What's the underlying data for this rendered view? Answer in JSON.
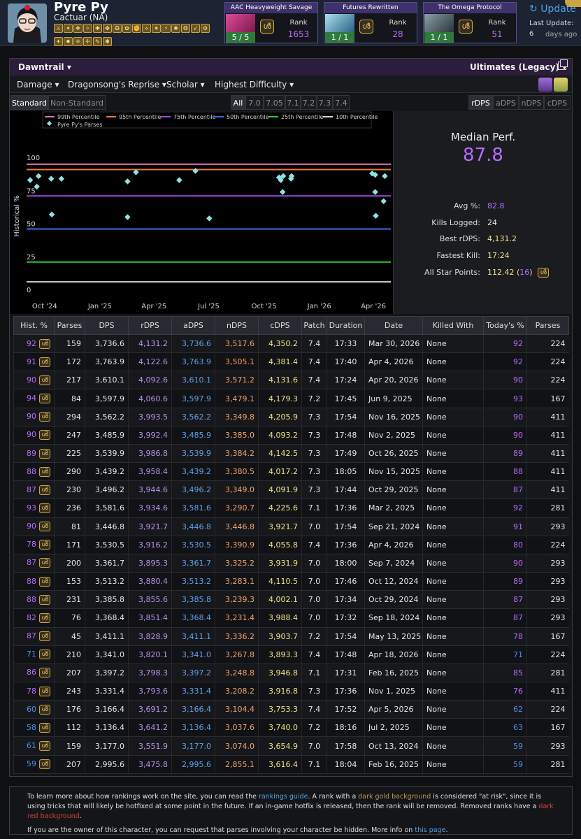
{
  "character": {
    "name": "Pyre Py",
    "server": "Cactuar (NA)"
  },
  "job_icons": [
    "paladin-icon",
    "warrior-icon",
    "dark-knight-icon",
    "gunbreaker-icon",
    "white-mage-icon",
    "scholar-icon",
    "astrologian-icon",
    "sage-icon",
    "monk-icon",
    "dragoon-icon",
    "ninja-icon",
    "samurai-icon",
    "reaper-icon",
    "viper-icon",
    "bard-icon",
    "machinist-icon",
    "dancer-icon",
    "black-mage-icon",
    "summoner-icon",
    "red-mage-icon",
    "pictomancer-icon",
    "blue-mage-icon"
  ],
  "raids": [
    {
      "title": "AAC Heavyweight Savage",
      "kills": "5 / 5",
      "rank_label": "Rank",
      "rank": "1653",
      "kills_bg": "#2e7a3a"
    },
    {
      "title": "Futures Rewritten",
      "kills": "1 / 1",
      "rank_label": "Rank",
      "rank": "28",
      "kills_bg": "#2e7a3a"
    },
    {
      "title": "The Omega Protocol",
      "kills": "1 / 1",
      "rank_label": "Rank",
      "rank": "51",
      "kills_bg": "#2e7a3a"
    }
  ],
  "update": {
    "button_label": "Update",
    "last_update_label": "Last Update:",
    "last_update_value": "6",
    "last_update_ago": "days ago"
  },
  "expac_bar": {
    "expansion": "Dawntrail",
    "zone": "Ultimates (Legacy)"
  },
  "filters": {
    "metric": "Damage",
    "encounter": "Dragonsong's Reprise",
    "job": "Scholar",
    "difficulty": "Highest Difficulty"
  },
  "tabs": {
    "partition": [
      "Standard",
      "Non-Standard"
    ],
    "patches": [
      "All",
      "7.0",
      "7.05",
      "7.1",
      "7.2",
      "7.3",
      "7.4"
    ],
    "metrics": [
      "rDPS",
      "aDPS",
      "nDPS",
      "cDPS"
    ]
  },
  "chart_data": {
    "type": "line",
    "ylabel": "Historical %",
    "ylim": [
      0,
      100
    ],
    "yticks": [
      "0",
      "25",
      "50",
      "75",
      "100"
    ],
    "xticks": [
      "Oct '24",
      "Jan '25",
      "Apr '25",
      "Jul '25",
      "Oct '25",
      "Jan '26",
      "Apr '26"
    ],
    "legend": [
      {
        "name": "99th Percentile",
        "color": "#e072b5"
      },
      {
        "name": "95th Percentile",
        "color": "#e87c3a"
      },
      {
        "name": "75th Percentile",
        "color": "#9a4ae0"
      },
      {
        "name": "50th Percentile",
        "color": "#3a6ee8"
      },
      {
        "name": "25th Percentile",
        "color": "#32c832"
      },
      {
        "name": "10th Percentile",
        "color": "#d8d8d8"
      },
      {
        "name": "Pyre Py's Parses",
        "color": "#8fe3e3"
      }
    ],
    "percentile_lines": [
      {
        "name": "99th Percentile",
        "value": 99
      },
      {
        "name": "95th Percentile",
        "value": 95
      },
      {
        "name": "75th Percentile",
        "value": 75
      },
      {
        "name": "50th Percentile",
        "value": 50
      },
      {
        "name": "25th Percentile",
        "value": 25
      },
      {
        "name": "10th Percentile",
        "value": 10
      }
    ],
    "parses": [
      {
        "date": "2024-09-07",
        "value": 87
      },
      {
        "date": "2024-09-18",
        "value": 82
      },
      {
        "date": "2024-09-21",
        "value": 90
      },
      {
        "date": "2024-10-12",
        "value": 88
      },
      {
        "date": "2024-10-13",
        "value": 61
      },
      {
        "date": "2024-10-29",
        "value": 88
      },
      {
        "date": "2025-02-16",
        "value": 86
      },
      {
        "date": "2025-02-16",
        "value": 59
      },
      {
        "date": "2025-03-02",
        "value": 93
      },
      {
        "date": "2025-05-13",
        "value": 87
      },
      {
        "date": "2025-06-09",
        "value": 94
      },
      {
        "date": "2025-07-02",
        "value": 58
      },
      {
        "date": "2025-10-26",
        "value": 89
      },
      {
        "date": "2025-10-29",
        "value": 87
      },
      {
        "date": "2025-11-01",
        "value": 78
      },
      {
        "date": "2025-11-02",
        "value": 90
      },
      {
        "date": "2025-11-15",
        "value": 88
      },
      {
        "date": "2025-11-16",
        "value": 90
      },
      {
        "date": "2026-03-30",
        "value": 92
      },
      {
        "date": "2026-04-04",
        "value": 91
      },
      {
        "date": "2026-04-04",
        "value": 78
      },
      {
        "date": "2026-04-05",
        "value": 60
      },
      {
        "date": "2026-04-18",
        "value": 71
      },
      {
        "date": "2026-04-20",
        "value": 90
      }
    ]
  },
  "stats": {
    "median_title": "Median Perf.",
    "median_value": "87.8",
    "rows": [
      {
        "label": "Avg %:",
        "value": "82.8",
        "color": "#b76bff"
      },
      {
        "label": "Kills Logged:",
        "value": "24",
        "color": "#e8e8e8"
      },
      {
        "label": "Best rDPS:",
        "value": "4,131.2",
        "color": "#f1e389"
      },
      {
        "label": "Fastest Kill:",
        "value": "17:24",
        "color": "#f1e389"
      },
      {
        "label": "All Star Points:",
        "value": "112.42",
        "extra": "16",
        "color": "#f1e389"
      }
    ]
  },
  "table": {
    "headers": [
      "Hist. %",
      "Parses",
      "DPS",
      "rDPS",
      "aDPS",
      "nDPS",
      "cDPS",
      "Patch",
      "Duration",
      "Date",
      "Killed With",
      "Today's %",
      "Parses"
    ],
    "rows": [
      [
        "92",
        "159",
        "3,736.6",
        "4,131.2",
        "3,736.6",
        "3,517.6",
        "4,350.2",
        "7.4",
        "17:33",
        "Mar 30, 2026",
        "None",
        "92",
        "224"
      ],
      [
        "91",
        "172",
        "3,763.9",
        "4,122.6",
        "3,763.9",
        "3,505.1",
        "4,381.4",
        "7.4",
        "17:40",
        "Apr 4, 2026",
        "None",
        "92",
        "224"
      ],
      [
        "90",
        "217",
        "3,610.1",
        "4,092.6",
        "3,610.1",
        "3,571.2",
        "4,131.6",
        "7.4",
        "17:24",
        "Apr 20, 2026",
        "None",
        "90",
        "224"
      ],
      [
        "94",
        "84",
        "3,597.9",
        "4,060.6",
        "3,597.9",
        "3,479.1",
        "4,179.3",
        "7.2",
        "17:45",
        "Jun 9, 2025",
        "None",
        "93",
        "167"
      ],
      [
        "90",
        "294",
        "3,562.2",
        "3,993.5",
        "3,562.2",
        "3,349.8",
        "4,205.9",
        "7.3",
        "17:54",
        "Nov 16, 2025",
        "None",
        "90",
        "411"
      ],
      [
        "90",
        "247",
        "3,485.9",
        "3,992.4",
        "3,485.9",
        "3,385.0",
        "4,093.2",
        "7.3",
        "17:48",
        "Nov 2, 2025",
        "None",
        "90",
        "411"
      ],
      [
        "89",
        "225",
        "3,539.9",
        "3,986.8",
        "3,539.9",
        "3,384.2",
        "4,142.5",
        "7.3",
        "17:49",
        "Oct 26, 2025",
        "None",
        "89",
        "411"
      ],
      [
        "88",
        "290",
        "3,439.2",
        "3,958.4",
        "3,439.2",
        "3,380.5",
        "4,017.2",
        "7.3",
        "18:05",
        "Nov 15, 2025",
        "None",
        "88",
        "411"
      ],
      [
        "87",
        "230",
        "3,496.2",
        "3,944.6",
        "3,496.2",
        "3,349.0",
        "4,091.9",
        "7.3",
        "17:44",
        "Oct 29, 2025",
        "None",
        "87",
        "411"
      ],
      [
        "93",
        "236",
        "3,581.6",
        "3,934.6",
        "3,581.6",
        "3,290.7",
        "4,225.6",
        "7.1",
        "17:36",
        "Mar 2, 2025",
        "None",
        "92",
        "281"
      ],
      [
        "90",
        "81",
        "3,446.8",
        "3,921.7",
        "3,446.8",
        "3,446.8",
        "3,921.7",
        "7.0",
        "17:54",
        "Sep 21, 2024",
        "None",
        "91",
        "293"
      ],
      [
        "78",
        "171",
        "3,530.5",
        "3,916.2",
        "3,530.5",
        "3,390.9",
        "4,055.8",
        "7.4",
        "17:36",
        "Apr 4, 2026",
        "None",
        "80",
        "224"
      ],
      [
        "87",
        "200",
        "3,361.7",
        "3,895.3",
        "3,361.7",
        "3,325.2",
        "3,931.9",
        "7.0",
        "18:00",
        "Sep 7, 2024",
        "None",
        "90",
        "293"
      ],
      [
        "88",
        "153",
        "3,513.2",
        "3,880.4",
        "3,513.2",
        "3,283.1",
        "4,110.5",
        "7.0",
        "17:46",
        "Oct 12, 2024",
        "None",
        "89",
        "293"
      ],
      [
        "88",
        "231",
        "3,385.8",
        "3,855.6",
        "3,385.8",
        "3,239.3",
        "4,002.1",
        "7.0",
        "17:34",
        "Oct 29, 2024",
        "None",
        "87",
        "293"
      ],
      [
        "82",
        "76",
        "3,368.4",
        "3,851.4",
        "3,368.4",
        "3,231.4",
        "3,988.4",
        "7.0",
        "17:32",
        "Sep 18, 2024",
        "None",
        "87",
        "293"
      ],
      [
        "87",
        "45",
        "3,411.1",
        "3,828.9",
        "3,411.1",
        "3,336.2",
        "3,903.7",
        "7.2",
        "17:54",
        "May 13, 2025",
        "None",
        "78",
        "167"
      ],
      [
        "71",
        "210",
        "3,341.0",
        "3,820.1",
        "3,341.0",
        "3,267.8",
        "3,893.3",
        "7.4",
        "17:48",
        "Apr 18, 2026",
        "None",
        "71",
        "224"
      ],
      [
        "86",
        "207",
        "3,397.2",
        "3,798.3",
        "3,397.2",
        "3,248.8",
        "3,946.8",
        "7.1",
        "17:31",
        "Feb 16, 2025",
        "None",
        "85",
        "281"
      ],
      [
        "78",
        "243",
        "3,331.4",
        "3,793.6",
        "3,331.4",
        "3,208.2",
        "3,916.8",
        "7.3",
        "17:36",
        "Nov 1, 2025",
        "None",
        "76",
        "411"
      ],
      [
        "60",
        "176",
        "3,166.4",
        "3,691.2",
        "3,166.4",
        "3,104.4",
        "3,753.3",
        "7.4",
        "17:52",
        "Apr 5, 2026",
        "None",
        "62",
        "224"
      ],
      [
        "58",
        "112",
        "3,136.4",
        "3,641.2",
        "3,136.4",
        "3,037.6",
        "3,740.0",
        "7.2",
        "18:16",
        "Jul 2, 2025",
        "None",
        "63",
        "167"
      ],
      [
        "61",
        "159",
        "3,177.0",
        "3,551.9",
        "3,177.0",
        "3,074.0",
        "3,654.9",
        "7.0",
        "17:58",
        "Oct 13, 2024",
        "None",
        "59",
        "293"
      ],
      [
        "59",
        "207",
        "2,995.6",
        "3,475.8",
        "2,995.6",
        "2,855.1",
        "3,616.4",
        "7.1",
        "18:04",
        "Feb 16, 2025",
        "None",
        "59",
        "281"
      ]
    ]
  },
  "footer": {
    "p1_a": "To learn more about how rankings work on the site, you can read the ",
    "p1_link": "rankings guide",
    "p1_b": ". A rank with a ",
    "p1_gold": "dark gold background",
    "p1_c": " is considered \"at risk\", since it is using tricks that will likely be hotfixed at some point in the future. If an in-game hotfix is released, then the rank will be removed. Removed ranks have a ",
    "p1_red": "dark red background",
    "p1_d": ".",
    "p2_a": "If you are the owner of this character, you can request that parses involving your character be hidden. More info on ",
    "p2_link": "this page",
    "p2_b": "."
  }
}
